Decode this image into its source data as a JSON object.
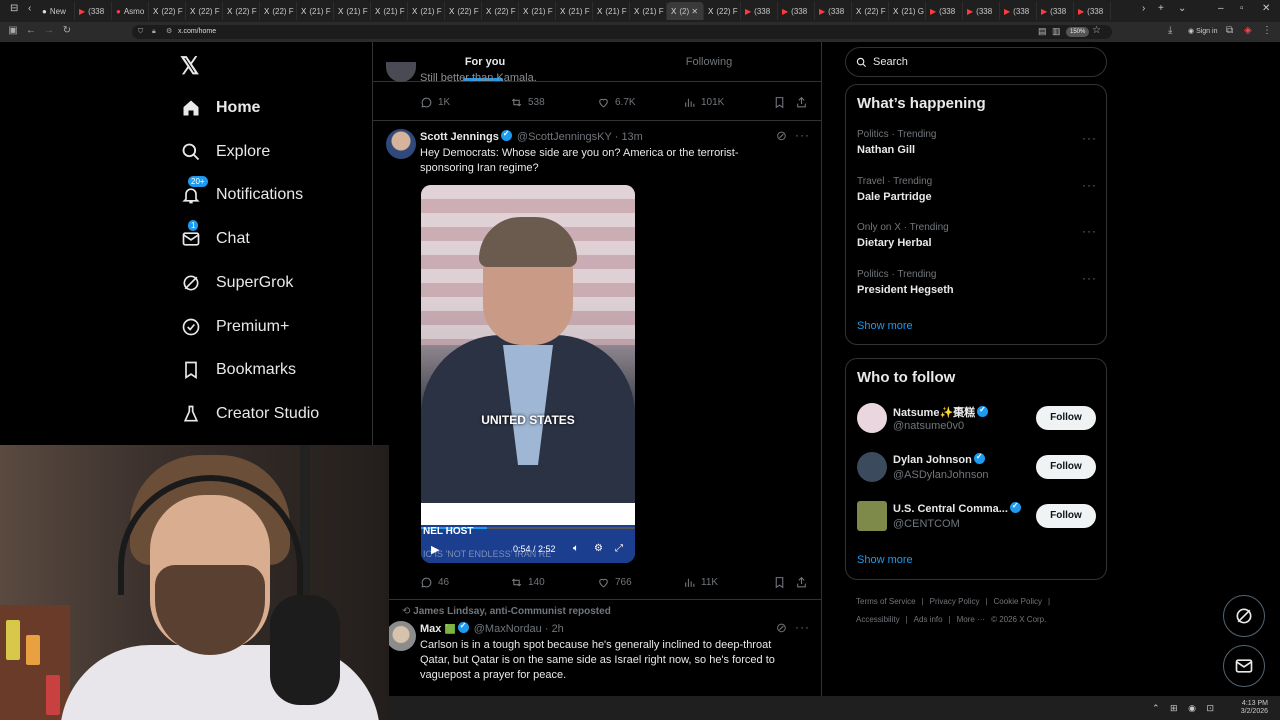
{
  "browser": {
    "tabs": [
      {
        "icon": "●",
        "red": false,
        "label": "New"
      },
      {
        "icon": "▶",
        "red": true,
        "label": "(338"
      },
      {
        "icon": "●",
        "red": true,
        "label": "Asmo"
      },
      {
        "icon": "X",
        "red": false,
        "label": "(22) F"
      },
      {
        "icon": "X",
        "red": false,
        "label": "(22) F"
      },
      {
        "icon": "X",
        "red": false,
        "label": "(22) F"
      },
      {
        "icon": "X",
        "red": false,
        "label": "(22) F"
      },
      {
        "icon": "X",
        "red": false,
        "label": "(21) F"
      },
      {
        "icon": "X",
        "red": false,
        "label": "(21) F"
      },
      {
        "icon": "X",
        "red": false,
        "label": "(21) F"
      },
      {
        "icon": "X",
        "red": false,
        "label": "(21) F"
      },
      {
        "icon": "X",
        "red": false,
        "label": "(22) F"
      },
      {
        "icon": "X",
        "red": false,
        "label": "(22) F"
      },
      {
        "icon": "X",
        "red": false,
        "label": "(21) F"
      },
      {
        "icon": "X",
        "red": false,
        "label": "(21) F"
      },
      {
        "icon": "X",
        "red": false,
        "label": "(21) F"
      },
      {
        "icon": "X",
        "red": false,
        "label": "(21) F"
      },
      {
        "icon": "X",
        "red": false,
        "label": "(2) ✕"
      },
      {
        "icon": "X",
        "red": false,
        "label": "(22) F"
      },
      {
        "icon": "▶",
        "red": true,
        "label": "(338"
      },
      {
        "icon": "▶",
        "red": true,
        "label": "(338"
      },
      {
        "icon": "▶",
        "red": true,
        "label": "(338"
      },
      {
        "icon": "X",
        "red": false,
        "label": "(22) F"
      },
      {
        "icon": "X",
        "red": false,
        "label": "(21) G"
      },
      {
        "icon": "▶",
        "red": true,
        "label": "(338"
      },
      {
        "icon": "▶",
        "red": true,
        "label": "(338"
      },
      {
        "icon": "▶",
        "red": true,
        "label": "(338"
      },
      {
        "icon": "▶",
        "red": true,
        "label": "(338"
      },
      {
        "icon": "▶",
        "red": true,
        "label": "(338"
      }
    ],
    "url": "x.com/home",
    "zoom": "150%",
    "signin": "Sign in"
  },
  "sidebar": {
    "logo": "𝕏",
    "items": [
      {
        "label": "Home",
        "icon": "home-icon"
      },
      {
        "label": "Explore",
        "icon": "search-icon"
      },
      {
        "label": "Notifications",
        "icon": "bell-icon",
        "badge": "20+"
      },
      {
        "label": "Chat",
        "icon": "mail-icon",
        "badge": "1"
      },
      {
        "label": "SuperGrok",
        "icon": "grok-icon"
      },
      {
        "label": "Premium+",
        "icon": "verified-icon"
      },
      {
        "label": "Bookmarks",
        "icon": "bookmark-icon"
      },
      {
        "label": "Creator Studio",
        "icon": "flask-icon"
      }
    ]
  },
  "timeline": {
    "tabs": [
      "For you",
      "Following"
    ],
    "top_tweet": {
      "partial_text": "Still better than Kamala.",
      "replies": "1K",
      "reposts": "538",
      "likes": "6.7K",
      "views": "101K"
    },
    "tweet1": {
      "name": "Scott Jennings",
      "handle": "@ScottJenningsKY",
      "time": "· 13m",
      "text": "Hey Democrats: Whose side are you on? America or the terrorist-sponsoring Iran regime?",
      "video": {
        "caption": "UNITED STATES",
        "lower_third": "NEL HOST",
        "ticker": "IC IS 'NOT ENDLESS' IRAN RE",
        "time": "0:54 / 2:52",
        "progress": 0.31
      },
      "replies": "46",
      "reposts": "140",
      "likes": "766",
      "views": "11K"
    },
    "tweet2": {
      "reposted_by": "James Lindsay, anti-Communist reposted",
      "name": "Max",
      "flag": "🟩",
      "handle": "@MaxNordau",
      "time": "· 2h",
      "text": "Carlson is in a tough spot because he's generally inclined to deep-throat Qatar, but Qatar is on the same side as Israel right now, so he's forced to vaguepost a prayer for peace."
    }
  },
  "right": {
    "search_placeholder": "Search",
    "happening": {
      "title": "What’s happening",
      "trends": [
        {
          "category": "Politics · Trending",
          "name": "Nathan Gill"
        },
        {
          "category": "Travel · Trending",
          "name": "Dale Partridge"
        },
        {
          "category": "Only on X · Trending",
          "name": "Dietary Herbal"
        },
        {
          "category": "Politics · Trending",
          "name": "President Hegseth"
        }
      ],
      "show_more": "Show more"
    },
    "who_to_follow": {
      "title": "Who to follow",
      "people": [
        {
          "name": "Natsume✨棗糕",
          "handle": "@natsume0v0",
          "follow": "Follow",
          "color": "#e9d6df"
        },
        {
          "name": "Dylan Johnson",
          "handle": "@ASDylanJohnson",
          "follow": "Follow",
          "color": "#3b4a5c"
        },
        {
          "name": "U.S. Central Comma...",
          "handle": "@CENTCOM",
          "follow": "Follow",
          "color": "#7d8a4a"
        }
      ],
      "show_more": "Show more"
    },
    "footer": {
      "line1": [
        "Terms of Service",
        "|",
        "Privacy Policy",
        "|",
        "Cookie Policy",
        "|"
      ],
      "line2": [
        "Accessibility",
        "|",
        "Ads info",
        "|",
        "More ···",
        "© 2026 X Corp."
      ]
    }
  },
  "taskbar": {
    "time": "4:13 PM",
    "date": "3/2/2026",
    "icons": "⌃ ⊞ ◉ ⊡"
  }
}
